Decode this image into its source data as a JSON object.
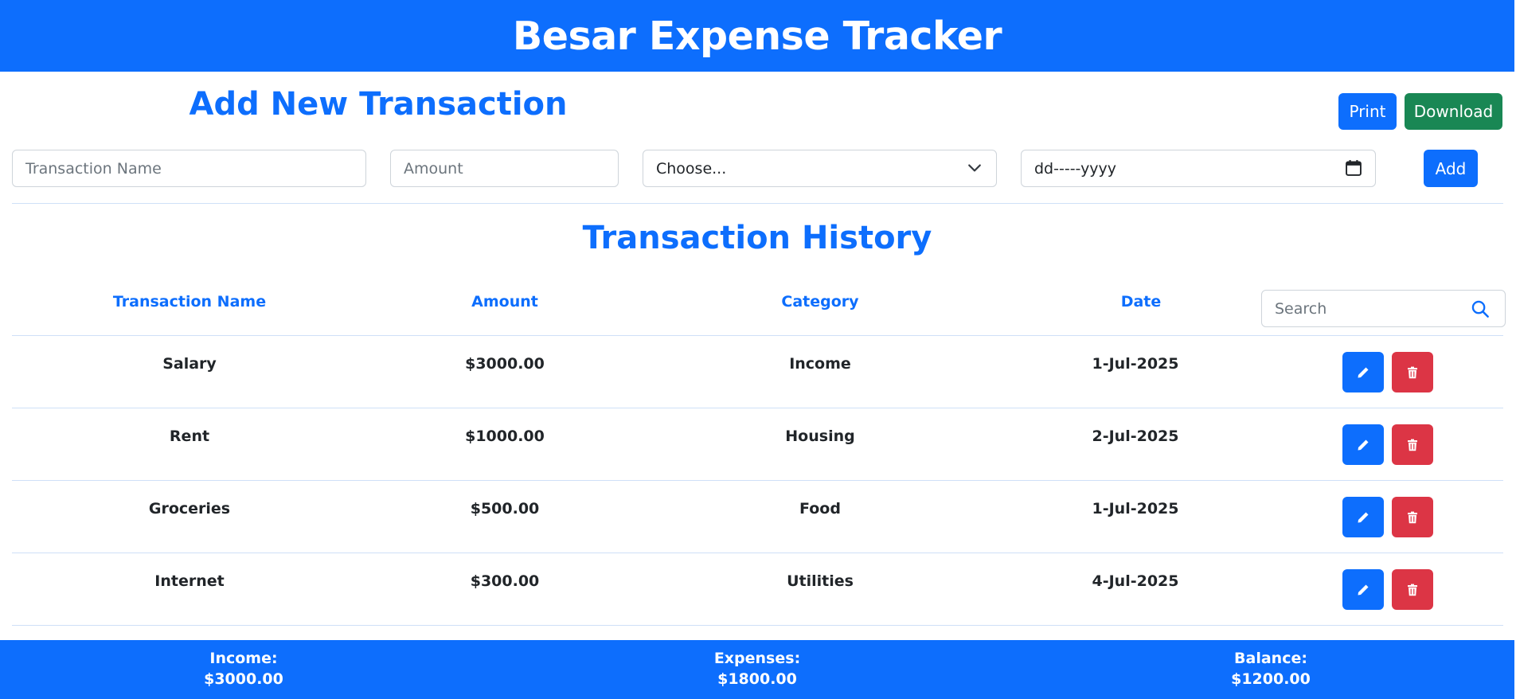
{
  "header": {
    "title": "Besar Expense Tracker"
  },
  "form": {
    "title": "Add New Transaction",
    "name_placeholder": "Transaction Name",
    "amount_placeholder": "Amount",
    "category_value": "Choose...",
    "date_value": "dd-----yyyy",
    "add_label": "Add"
  },
  "toolbar": {
    "print_label": "Print",
    "download_label": "Download"
  },
  "history": {
    "title": "Transaction History",
    "columns": [
      "Transaction Name",
      "Amount",
      "Category",
      "Date"
    ],
    "search_placeholder": "Search",
    "rows": [
      {
        "name": "Salary",
        "amount": "$3000.00",
        "category": "Income",
        "date": "1-Jul-2025"
      },
      {
        "name": "Rent",
        "amount": "$1000.00",
        "category": "Housing",
        "date": "2-Jul-2025"
      },
      {
        "name": "Groceries",
        "amount": "$500.00",
        "category": "Food",
        "date": "1-Jul-2025"
      },
      {
        "name": "Internet",
        "amount": "$300.00",
        "category": "Utilities",
        "date": "4-Jul-2025"
      }
    ]
  },
  "summary": {
    "income_label": "Income:",
    "income_value": "$3000.00",
    "expenses_label": "Expenses:",
    "expenses_value": "$1800.00",
    "balance_label": "Balance:",
    "balance_value": "$1200.00"
  },
  "colors": {
    "primary": "#0d6efd",
    "success": "#198754",
    "danger": "#dc3545"
  }
}
